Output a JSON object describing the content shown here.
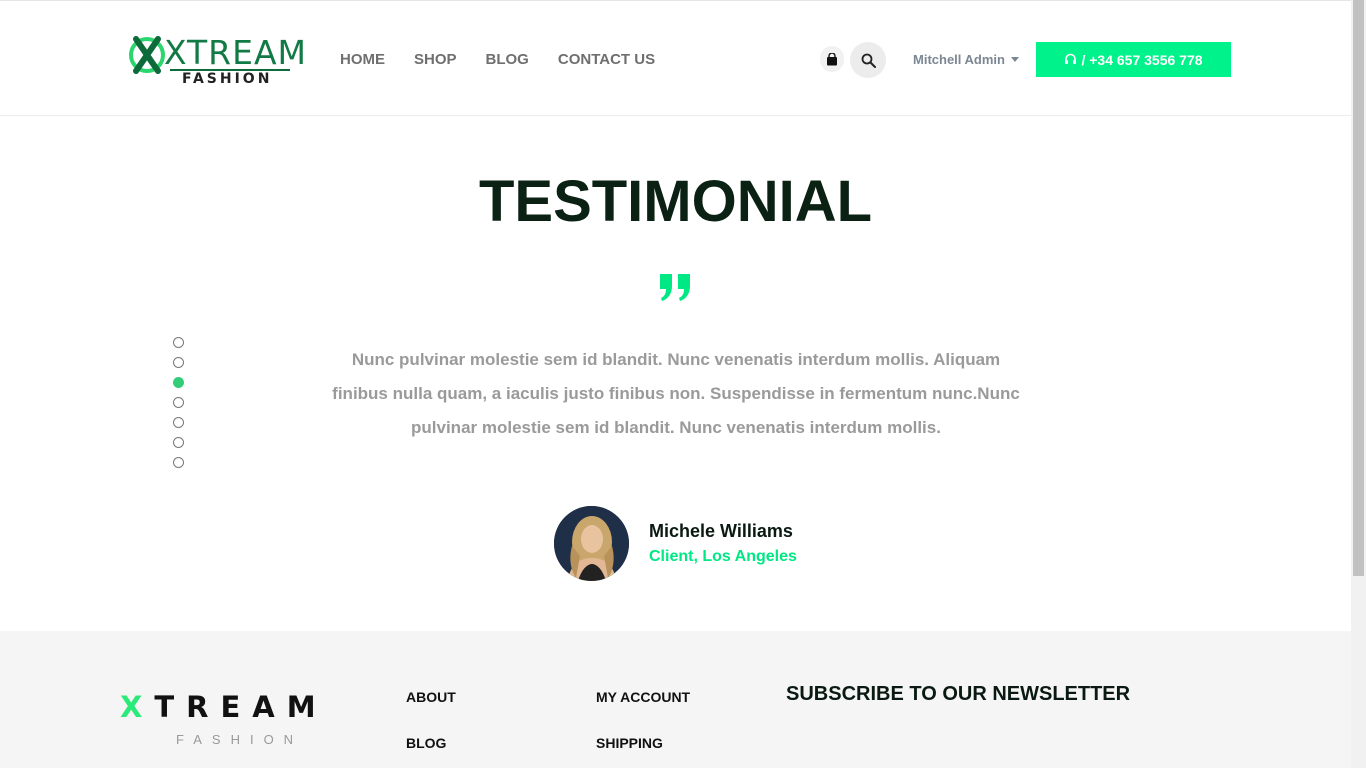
{
  "logo": {
    "brand": "XTREAM",
    "sub": "FASHION"
  },
  "nav": [
    {
      "label": "HOME"
    },
    {
      "label": "SHOP"
    },
    {
      "label": "BLOG"
    },
    {
      "label": "CONTACT US"
    }
  ],
  "header": {
    "user_label": "Mitchell Admin",
    "phone_label": "/ +34 657 3556 778"
  },
  "testimonial": {
    "title": "TESTIMONIAL",
    "quote": "Nunc pulvinar molestie sem id blandit. Nunc venenatis interdum mollis. Aliquam finibus nulla quam, a iaculis justo finibus non. Suspendisse in fermentum nunc.Nunc pulvinar molestie sem id blandit. Nunc venenatis interdum mollis.",
    "author_name": "Michele Williams",
    "author_role": "Client, Los Angeles",
    "slides_total": 7,
    "active_slide": 3
  },
  "footer": {
    "logo_big": "TREAM",
    "logo_x": "X",
    "logo_small": "FASHION",
    "links_col1": [
      "ABOUT",
      "BLOG"
    ],
    "links_col2": [
      "MY ACCOUNT",
      "SHIPPING"
    ],
    "newsletter_title": "SUBSCRIBE TO OUR NEWSLETTER"
  },
  "colors": {
    "accent": "#00f28a",
    "title": "#0a2114",
    "muted_text": "#9a9a9a"
  },
  "icons": {
    "cart": "shopping-bag-icon",
    "search": "search-icon",
    "phone": "headset-icon",
    "quote": "quote-icon"
  }
}
